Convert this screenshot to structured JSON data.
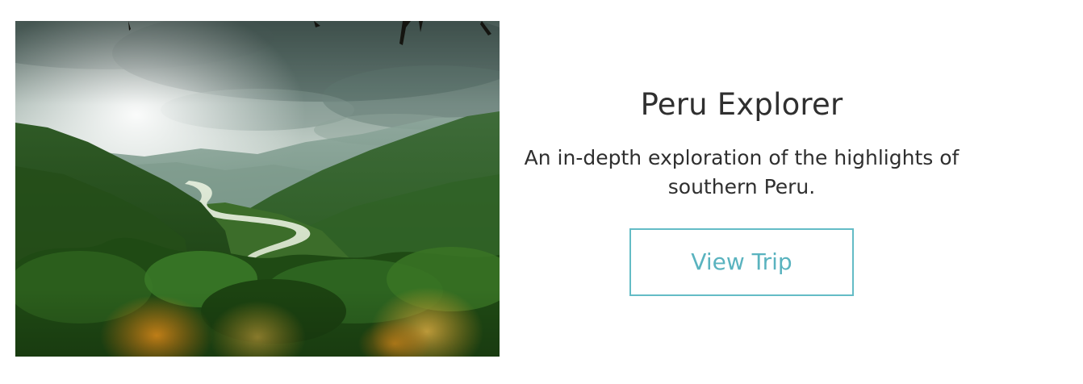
{
  "trip": {
    "title": "Peru Explorer",
    "description": "An in-depth exploration of the highlights of southern Peru.",
    "button_label": "View Trip",
    "image_subject": "Andean jungle valley with winding river"
  },
  "colors": {
    "accent": "#5ab3bf",
    "text": "#2f2f2f",
    "background": "#ffffff"
  }
}
